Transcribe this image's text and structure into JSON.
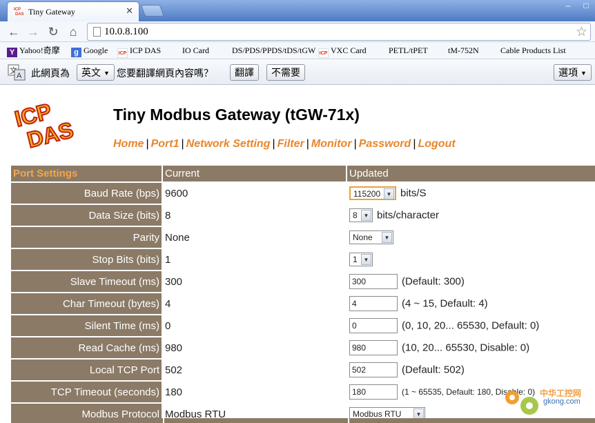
{
  "browser": {
    "tab_title": "Tiny Gateway",
    "url": "10.0.8.100",
    "bookmarks": [
      "Yahoo!奇摩",
      "Google",
      "ICP DAS",
      "IO Card",
      "DS/PDS/PPDS/tDS/tGW",
      "VXC Card",
      "PETL/tPET",
      "tM-752N",
      "Cable Products List"
    ]
  },
  "translate_bar": {
    "prompt_prefix": "此網頁為",
    "language": "英文",
    "question": "您要翻譯網頁內容嗎？",
    "translate_button": "翻譯",
    "dismiss_button": "不需要",
    "options_button": "選項"
  },
  "header": {
    "logo_text": "ICP DAS",
    "title": "Tiny Modbus Gateway (tGW-71x)",
    "menu": [
      "Home",
      "Port1",
      "Network Setting",
      "Filter",
      "Monitor",
      "Password",
      "Logout"
    ]
  },
  "table": {
    "headers": {
      "settings": "Port Settings",
      "current": "Current",
      "updated": "Updated"
    },
    "rows": [
      {
        "label": "Baud Rate (bps)",
        "current": "9600",
        "value": "115200",
        "hint": "bits/S"
      },
      {
        "label": "Data Size (bits)",
        "current": "8",
        "value": "8",
        "hint": "bits/character"
      },
      {
        "label": "Parity",
        "current": "None",
        "value": "None",
        "hint": ""
      },
      {
        "label": "Stop Bits (bits)",
        "current": "1",
        "value": "1",
        "hint": ""
      },
      {
        "label": "Slave Timeout (ms)",
        "current": "300",
        "value": "300",
        "hint": "(Default: 300)"
      },
      {
        "label": "Char Timeout (bytes)",
        "current": "4",
        "value": "4",
        "hint": "(4 ~ 15, Default: 4)"
      },
      {
        "label": "Silent Time (ms)",
        "current": "0",
        "value": "0",
        "hint": "(0, 10, 20... 65530, Default: 0)"
      },
      {
        "label": "Read Cache (ms)",
        "current": "980",
        "value": "980",
        "hint": "(10, 20... 65530, Disable: 0)"
      },
      {
        "label": "Local TCP Port",
        "current": "502",
        "value": "502",
        "hint": "(Default: 502)"
      },
      {
        "label": "TCP Timeout (seconds)",
        "current": "180",
        "value": "180",
        "hint": "(1 ~ 65535, Default: 180, Disable: 0)"
      },
      {
        "label": "Modbus Protocol",
        "current": "Modbus RTU",
        "value": "Modbus RTU",
        "hint": ""
      }
    ]
  },
  "watermark": {
    "text": "中华工控网",
    "sub": "gkong.com"
  },
  "colors": {
    "accent": "#e8862b",
    "label_bg": "#8b7a66",
    "header_text": "#f3a64a"
  }
}
